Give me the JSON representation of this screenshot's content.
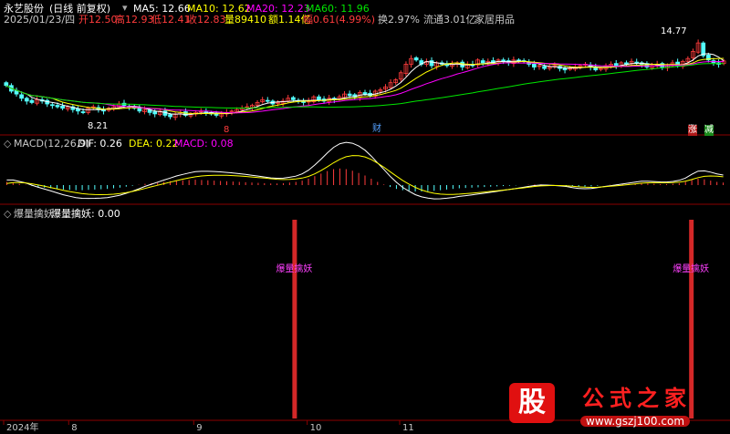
{
  "header": {
    "stock_name": "永艺股份",
    "period": "(日线 前复权)",
    "ma5_label": "MA5: 12.66",
    "ma10_label": "MA10: 12.62",
    "ma20_label": "MA20: 12.23",
    "ma60_label": "MA60: 11.96",
    "date_label": "2025/01/23/四",
    "open_label": "开12.50",
    "high_label": "高12.93",
    "low_label": "低12.41",
    "close_label": "收12.83",
    "volume_label": "量89410",
    "amount_label": "额1.14亿",
    "change_label": "幅0.61(4.99%)",
    "turnover_label": "换2.97%",
    "float_label": "流通3.01亿",
    "industry_label": "家居用品"
  },
  "macd_header": {
    "name": "MACD(12,26,9)",
    "dif_label": "DIF: 0.26",
    "dea_label": "DEA: 0.22",
    "macd_label": "MACD: 0.08"
  },
  "signal_header": {
    "name": "爆量擒妖",
    "value_label": "爆量擒妖: 0.00"
  },
  "annotations": {
    "high_price": "14.77",
    "low_price": "8.21",
    "event_left": "8",
    "event_cai": "财",
    "event_zhang": "涨",
    "event_jian": "减"
  },
  "watermark": {
    "logo_char": "股",
    "site_name": "公式之家",
    "url": "www.gszj100.com"
  },
  "colors": {
    "up": "#ff3c3c",
    "down": "#54ffff",
    "ma5": "#ffffff",
    "ma10": "#ffff00",
    "ma20": "#ff00ff",
    "ma60": "#00e600",
    "signal": "#d42828",
    "grid": "#8b0000"
  },
  "chart_data": [
    {
      "type": "candlestick",
      "x_axis_labels": [
        "2024年",
        "8",
        "9",
        "10",
        "11"
      ],
      "price_extremes": {
        "high": 14.77,
        "low": 8.21
      },
      "ma_series": [
        {
          "name": "MA5",
          "last": 12.66
        },
        {
          "name": "MA10",
          "last": 12.62
        },
        {
          "name": "MA20",
          "last": 12.23
        },
        {
          "name": "MA60",
          "last": 11.96
        }
      ],
      "closes": [
        11.1,
        10.7,
        10.5,
        10.2,
        10.0,
        9.9,
        10.1,
        10.0,
        9.8,
        9.7,
        9.6,
        9.5,
        9.6,
        9.4,
        9.3,
        9.2,
        9.5,
        9.6,
        9.4,
        9.3,
        9.5,
        9.6,
        9.8,
        9.7,
        9.6,
        9.5,
        9.3,
        9.4,
        9.2,
        9.1,
        9.3,
        9.0,
        8.9,
        9.1,
        9.2,
        9.0,
        9.1,
        9.2,
        9.3,
        9.2,
        9.1,
        9.0,
        9.1,
        9.2,
        9.3,
        9.4,
        9.5,
        9.6,
        9.7,
        9.9,
        10.1,
        10.0,
        9.8,
        9.9,
        10.0,
        10.2,
        10.1,
        10.0,
        9.9,
        10.0,
        10.3,
        10.1,
        10.0,
        10.2,
        10.1,
        10.3,
        10.5,
        10.4,
        10.3,
        10.6,
        10.5,
        10.4,
        10.7,
        10.8,
        11.0,
        11.3,
        11.5,
        12.0,
        12.6,
        13.0,
        12.9,
        12.6,
        12.8,
        12.5,
        12.7,
        12.6,
        12.5,
        12.6,
        12.7,
        12.4,
        12.6,
        12.5,
        12.9,
        12.7,
        12.8,
        12.7,
        12.9,
        12.8,
        12.7,
        12.9,
        12.8,
        12.8,
        12.6,
        12.4,
        12.5,
        12.3,
        12.4,
        12.5,
        12.3,
        12.2,
        12.3,
        12.4,
        12.5,
        12.6,
        12.4,
        12.2,
        12.3,
        12.5,
        12.6,
        12.5,
        12.7,
        12.6,
        12.8,
        12.7,
        12.6,
        12.4,
        12.5,
        12.6,
        12.4,
        12.5,
        12.7,
        12.5,
        12.8,
        13.0,
        13.5,
        14.1,
        13.2,
        12.9,
        12.7,
        12.6,
        12.83
      ]
    },
    {
      "type": "bar",
      "name": "MACD(12,26,9)",
      "dif_last": 0.26,
      "dea_last": 0.22,
      "macd_last": 0.08,
      "values": [
        0.1,
        0.08,
        0.04,
        0.01,
        -0.03,
        -0.06,
        -0.08,
        -0.1,
        -0.12,
        -0.14,
        -0.15,
        -0.16,
        -0.16,
        -0.15,
        -0.14,
        -0.13,
        -0.12,
        -0.1,
        -0.08,
        -0.05,
        -0.02,
        0.01,
        0.04,
        0.06,
        0.08,
        0.1,
        0.12,
        0.14,
        0.15,
        0.16,
        0.17,
        0.16,
        0.15,
        0.14,
        0.13,
        0.12,
        0.11,
        0.1,
        0.09,
        0.08,
        0.07,
        0.06,
        0.05,
        0.05,
        0.06,
        0.08,
        0.1,
        0.14,
        0.2,
        0.28,
        0.36,
        0.44,
        0.5,
        0.52,
        0.5,
        0.45,
        0.38,
        0.3,
        0.2,
        0.1,
        0.02,
        -0.06,
        -0.12,
        -0.16,
        -0.18,
        -0.2,
        -0.2,
        -0.19,
        -0.18,
        -0.16,
        -0.14,
        -0.12,
        -0.1,
        -0.09,
        -0.08,
        -0.07,
        -0.06,
        -0.05,
        -0.04,
        -0.03,
        -0.02,
        -0.01,
        0.0,
        0.01,
        0.02,
        0.02,
        0.01,
        0.0,
        -0.01,
        -0.02,
        -0.04,
        -0.05,
        -0.05,
        -0.04,
        -0.02,
        0.0,
        0.01,
        0.02,
        0.03,
        0.04,
        0.05,
        0.06,
        0.05,
        0.04,
        0.03,
        0.03,
        0.04,
        0.06,
        0.1,
        0.16,
        0.2,
        0.18,
        0.14,
        0.1,
        0.08
      ]
    },
    {
      "type": "bar",
      "name": "爆量擒妖",
      "last_value": 0.0,
      "signals": [
        {
          "position": 0.402,
          "value": 1
        },
        {
          "position": 0.951,
          "value": 1
        }
      ]
    }
  ]
}
